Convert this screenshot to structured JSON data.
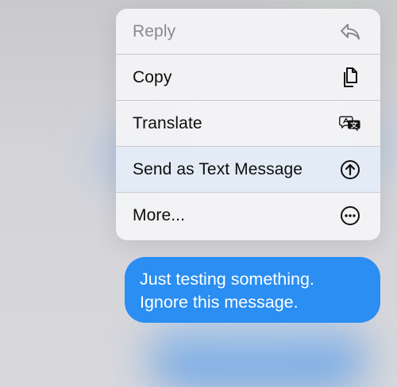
{
  "menu": {
    "items": [
      {
        "label": "Reply",
        "icon": "reply-icon",
        "enabled": false
      },
      {
        "label": "Copy",
        "icon": "copy-icon",
        "enabled": true
      },
      {
        "label": "Translate",
        "icon": "translate-icon",
        "enabled": true
      },
      {
        "label": "Send as Text Message",
        "icon": "arrow-up-circle-icon",
        "enabled": true
      },
      {
        "label": "More...",
        "icon": "ellipsis-circle-icon",
        "enabled": true
      }
    ]
  },
  "message": {
    "lines": [
      "Just testing something.",
      "Ignore this message."
    ],
    "bubble_color": "#2a8ef2",
    "text_color": "#ffffff"
  }
}
